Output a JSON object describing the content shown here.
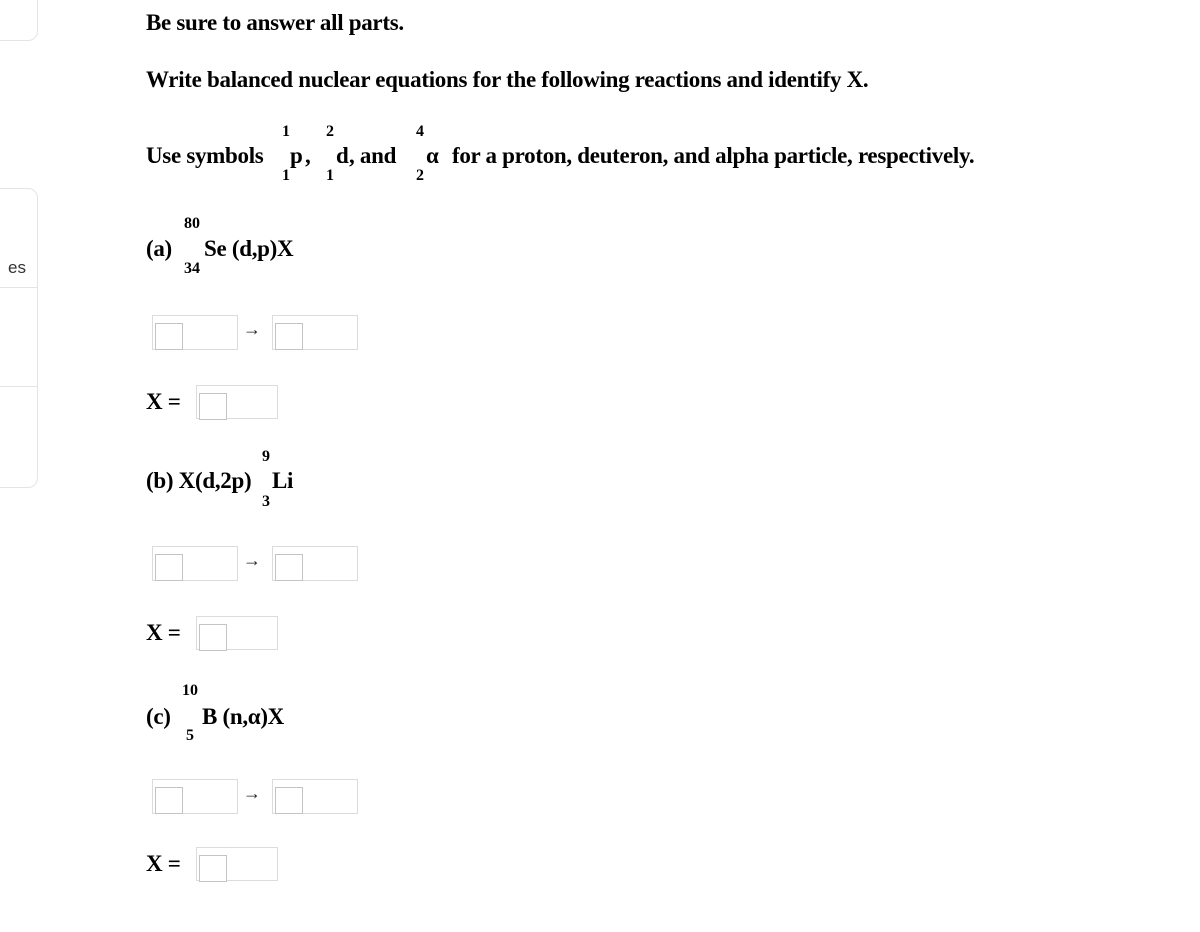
{
  "sidebar": {
    "nav_partial_label": "es"
  },
  "instructions": {
    "line1": "Be sure to answer all parts.",
    "line2": "Write balanced nuclear equations for the following reactions and identify X.",
    "line3_prefix": "Use symbols",
    "symbols": [
      {
        "mass": "1",
        "atomic": "1",
        "symbol": "p",
        "after": ","
      },
      {
        "mass": "2",
        "atomic": "1",
        "symbol": "d",
        "after": ", and"
      },
      {
        "mass": "4",
        "atomic": "2",
        "symbol": "α",
        "after": "for a proton, deuteron, and alpha particle, respectively."
      }
    ]
  },
  "parts": [
    {
      "label": "(a)",
      "mass": "80",
      "atomic": "34",
      "reaction": "Se (d,p)X",
      "arrow": "→",
      "x_label": "X ="
    },
    {
      "label": "(b) X(d,2p)",
      "mass": "9",
      "atomic": "3",
      "reaction": "Li",
      "arrow": "→",
      "x_label": "X ="
    },
    {
      "label": "(c)",
      "mass": "10",
      "atomic": "5",
      "reaction": "B (n,α)X",
      "arrow": "→",
      "x_label": "X ="
    }
  ]
}
